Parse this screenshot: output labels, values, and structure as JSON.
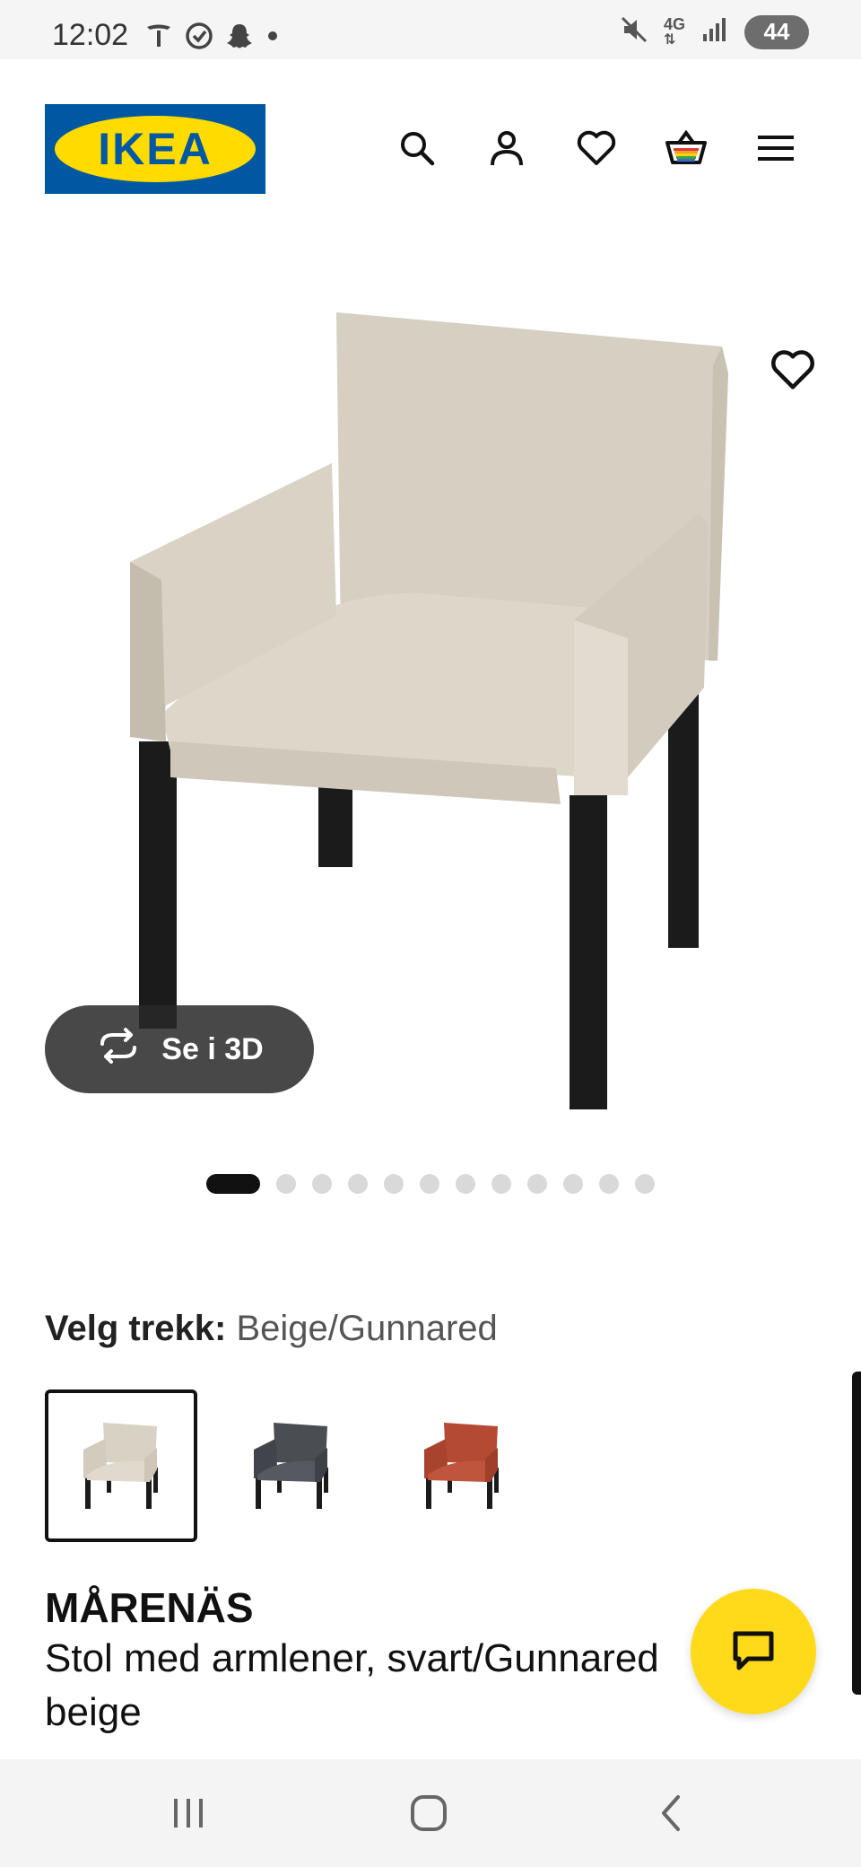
{
  "status": {
    "time": "12:02",
    "battery": "44",
    "network": "4G"
  },
  "header": {
    "logo_text": "IKEA"
  },
  "gallery": {
    "view_3d_label": "Se i 3D",
    "image_count": 12,
    "active_index": 0
  },
  "variant": {
    "label": "Velg trekk:",
    "value": "Beige/Gunnared",
    "options": [
      {
        "name": "Beige/Gunnared",
        "color": "#d8d2c4",
        "selected": true
      },
      {
        "name": "Dark grey",
        "color": "#4a4d52",
        "selected": false
      },
      {
        "name": "Red",
        "color": "#b44a33",
        "selected": false
      }
    ]
  },
  "product": {
    "name": "MÅRENÄS",
    "description": "Stol med armlener, svart/Gunnared beige"
  },
  "colors": {
    "ikea_blue": "#0058a3",
    "ikea_yellow": "#ffdb00",
    "fab_yellow": "#ffda1a"
  }
}
